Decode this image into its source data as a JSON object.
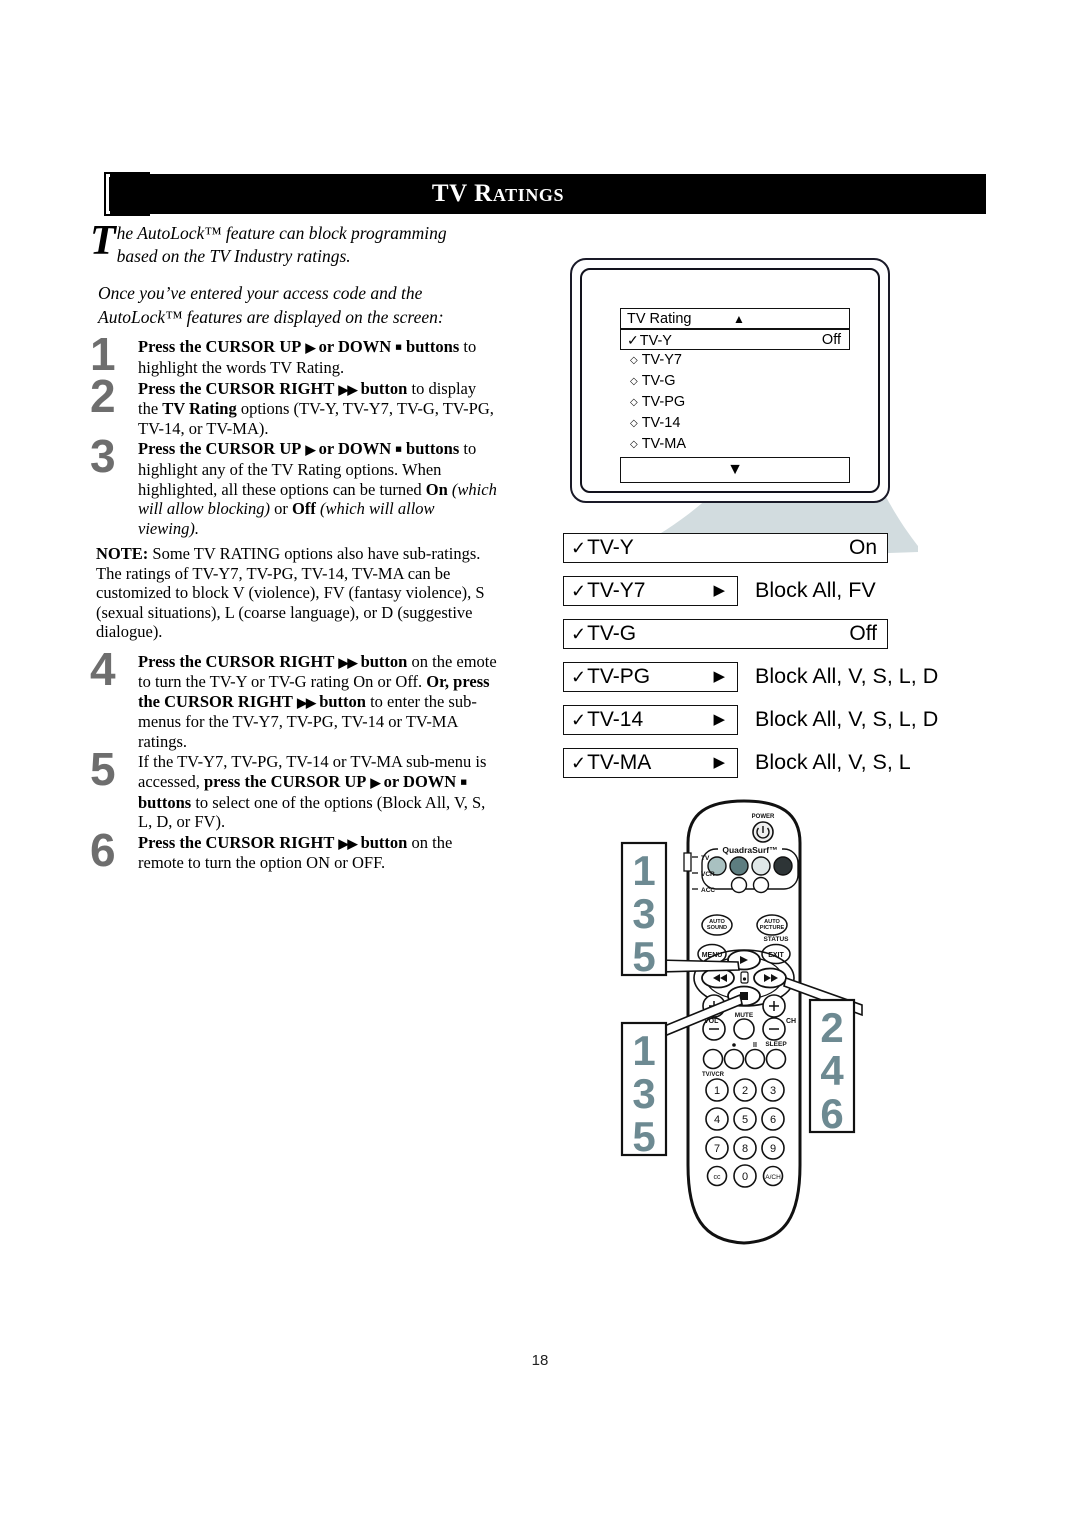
{
  "header": {
    "title": "TV Ratings",
    "icon": "autolock-blocked-hand-icon"
  },
  "intro": {
    "dropcap": "T",
    "line1": "he AutoLock™ feature can block programming",
    "line2": "based on the TV Industry ratings.",
    "paragraph2": "Once you’ve entered your access code and the AutoLock™ features are displayed on the screen:"
  },
  "steps": [
    {
      "number": "1",
      "b1": "Press the CURSOR UP",
      "g1": "▶",
      "b2": "or DOWN",
      "g2": "■",
      "b3": "buttons",
      "rest": "to highlight the words TV Rating."
    },
    {
      "number": "2",
      "b1": "Press the CURSOR RIGHT",
      "g1": "▶▶",
      "b2": "button",
      "r1": "to display the",
      "b3": "TV Rating",
      "r2": "options (TV-Y, TV-Y7, TV-G, TV-PG, TV-14, or TV-MA)."
    },
    {
      "number": "3",
      "b1": "Press the CURSOR UP",
      "g1": "▶",
      "b2": "or DOWN",
      "g2": "■",
      "b3": "buttons",
      "r1": "to highlight any of the TV Rating options. When highlighted, all these options can be turned",
      "b4": "On",
      "i1": "(which will allow blocking)",
      "r2": "or",
      "b5": "Off",
      "i2": "(which will allow viewing)."
    },
    {
      "number": "4",
      "b1": "Press the CURSOR RIGHT",
      "g1": "▶▶",
      "b2": "button",
      "r1": "on the emote to turn the TV-Y or TV-G rating On or Off.",
      "b3": "Or, press the CURSOR RIGHT",
      "g2": "▶▶",
      "b4": "button",
      "r2": "to enter the sub-menus for the TV-Y7, TV-PG, TV-14 or TV-MA ratings."
    },
    {
      "number": "5",
      "r0": "If the TV-Y7, TV-PG, TV-14 or TV-MA sub-menu is accessed,",
      "b1": "press the CURSOR UP",
      "g1": "▶",
      "b2": "or DOWN",
      "g2": "■",
      "b3": "buttons",
      "r1": "to select one of the options (Block All, V, S, L, D, or FV)."
    },
    {
      "number": "6",
      "b1": "Press the CURSOR RIGHT",
      "g1": "▶▶",
      "b2": "button",
      "r1": "on the remote to turn the option ON or OFF."
    }
  ],
  "note": {
    "label": "NOTE:",
    "text": " Some TV RATING options also have sub-ratings. The ratings of TV-Y7, TV-PG, TV-14, TV-MA can be customized to block V (violence), FV (fantasy violence), S (sexual situations), L (coarse language), or D (suggestive dialogue)."
  },
  "tv_screen": {
    "menu_title": "TV Rating",
    "scroll_up": "▲",
    "scroll_down": "▼",
    "selected_row": {
      "check": "✓",
      "label": "TV-Y",
      "value": "Off"
    },
    "options": [
      {
        "bullet": "◇",
        "label": "TV-Y7"
      },
      {
        "bullet": "◇",
        "label": "TV-G"
      },
      {
        "bullet": "◇",
        "label": "TV-PG"
      },
      {
        "bullet": "◇",
        "label": "TV-14"
      },
      {
        "bullet": "◇",
        "label": "TV-MA"
      }
    ]
  },
  "rating_rows": [
    {
      "check": "✓",
      "label": "TV-Y",
      "style": "wide",
      "value_inside": "On",
      "value_outside": "",
      "arrow": ""
    },
    {
      "check": "✓",
      "label": "TV-Y7",
      "style": "narrow",
      "value_inside": "",
      "value_outside": "Block All, FV",
      "arrow": "▶"
    },
    {
      "check": "✓",
      "label": "TV-G",
      "style": "wide",
      "value_inside": "Off",
      "value_outside": "",
      "arrow": ""
    },
    {
      "check": "✓",
      "label": "TV-PG",
      "style": "narrow",
      "value_inside": "",
      "value_outside": "Block All, V, S, L, D",
      "arrow": "▶"
    },
    {
      "check": "✓",
      "label": "TV-14",
      "style": "narrow",
      "value_inside": "",
      "value_outside": "Block All, V, S, L, D",
      "arrow": "▶"
    },
    {
      "check": "✓",
      "label": "TV-MA",
      "style": "narrow",
      "value_inside": "",
      "value_outside": "Block All, V, S, L",
      "arrow": "▶"
    }
  ],
  "remote": {
    "power_label": "POWER",
    "brand_label": "QuadraSurf™",
    "mode_labels": [
      "TV",
      "VCR",
      "ACC"
    ],
    "auto_sound": "AUTO SOUND",
    "auto_picture": "AUTO PICTURE",
    "status": "STATUS",
    "exit": "EXIT",
    "menu": "MENU",
    "mute": "MUTE",
    "vol": "VOL",
    "ch": "CH",
    "sleep": "SLEEP",
    "tv_vcr": "TV/VCR",
    "keypad": [
      "1",
      "2",
      "3",
      "4",
      "5",
      "6",
      "7",
      "8",
      "9",
      "cc",
      "0",
      "A/CH"
    ],
    "callout_left": [
      "1",
      "3",
      "5"
    ],
    "callout_right": [
      "2",
      "4",
      "6"
    ]
  },
  "footer": {
    "page_number": "18"
  },
  "colors": {
    "header_bar": "#000000",
    "step_number": "#6e6e6e",
    "callout_number": "#6d8a92",
    "swoosh": "#d2dcdf"
  }
}
